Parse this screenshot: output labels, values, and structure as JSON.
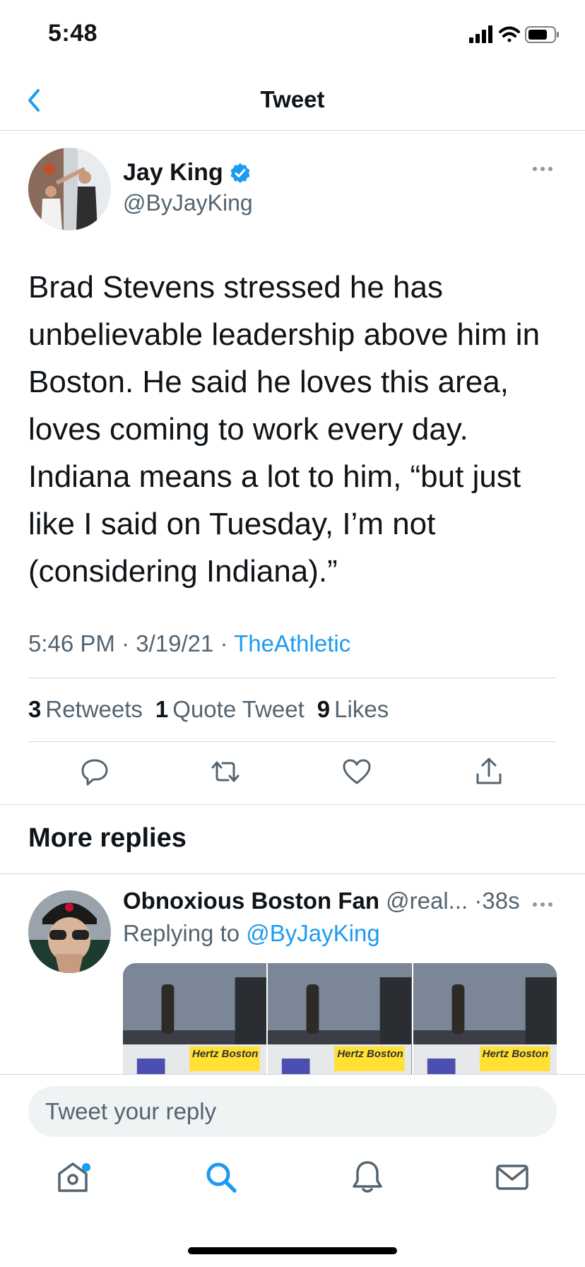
{
  "status_bar": {
    "time": "5:48"
  },
  "nav": {
    "title": "Tweet"
  },
  "tweet": {
    "author_name": "Jay King",
    "author_handle": "@ByJayKing",
    "text": "Brad Stevens stressed he has\nunbelievable leadership above him in\nBoston. He said he loves this area,\nloves coming to work every day.\nIndiana means a lot to him, “but just\nlike I said on Tuesday, I’m not\n(considering Indiana).”",
    "time": "5:46 PM",
    "date": "3/19/21",
    "source": "TheAthletic",
    "separator": "·"
  },
  "stats": {
    "retweets_count": "3",
    "retweets_label": "Retweets",
    "quotes_count": "1",
    "quotes_label": "Quote Tweet",
    "likes_count": "9",
    "likes_label": "Likes"
  },
  "section": {
    "title": "More replies"
  },
  "reply": {
    "name": "Obnoxious Boston Fan",
    "handle": "@real...",
    "time": "·38s",
    "replying_prefix": "Replying to",
    "replying_handle": "@ByJayKing",
    "media_signs": [
      "Hertz Boston",
      "Hertz Boston",
      "Hertz Boston"
    ]
  },
  "composer": {
    "placeholder": "Tweet your reply"
  },
  "colors": {
    "accent": "#1d9bf0",
    "secondary_text": "#536471",
    "divider": "#cfd9de"
  },
  "icons": [
    "back-chevron-icon",
    "verified-badge-icon",
    "more-icon",
    "reply-icon",
    "retweet-icon",
    "like-icon",
    "share-icon",
    "home-icon",
    "search-icon",
    "notifications-icon",
    "messages-icon"
  ]
}
